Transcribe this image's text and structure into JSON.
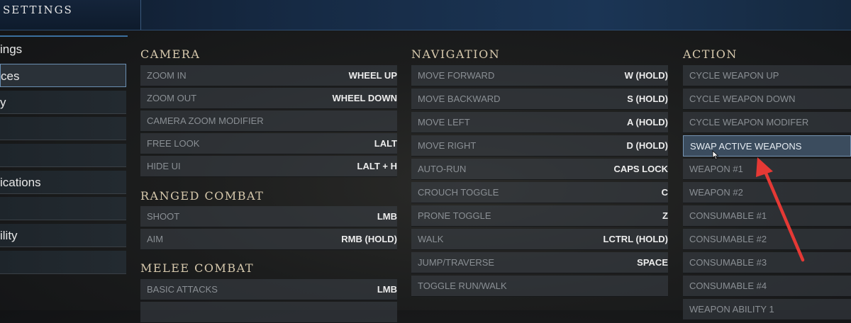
{
  "header": {
    "title": "SETTINGS"
  },
  "sidebar": {
    "items": [
      {
        "label": "ings"
      },
      {
        "label": "ces"
      },
      {
        "label": "y"
      },
      {
        "label": ""
      },
      {
        "label": ""
      },
      {
        "label": "ications"
      },
      {
        "label": ""
      },
      {
        "label": "ility"
      },
      {
        "label": ""
      }
    ]
  },
  "camera": {
    "title": "CAMERA",
    "rows": [
      {
        "label": "ZOOM IN",
        "key": "WHEEL UP"
      },
      {
        "label": "ZOOM OUT",
        "key": "WHEEL DOWN"
      },
      {
        "label": "CAMERA ZOOM MODIFIER",
        "key": ""
      },
      {
        "label": "FREE LOOK",
        "key": "LALT"
      },
      {
        "label": "HIDE UI",
        "key": "LALT + H"
      }
    ]
  },
  "ranged": {
    "title": "RANGED COMBAT",
    "rows": [
      {
        "label": "SHOOT",
        "key": "LMB"
      },
      {
        "label": "AIM",
        "key": "RMB (HOLD)"
      }
    ]
  },
  "melee": {
    "title": "MELEE COMBAT",
    "rows": [
      {
        "label": "BASIC ATTACKS",
        "key": "LMB"
      }
    ]
  },
  "navigation": {
    "title": "NAVIGATION",
    "rows": [
      {
        "label": "MOVE FORWARD",
        "key": "W (HOLD)"
      },
      {
        "label": "MOVE BACKWARD",
        "key": "S (HOLD)"
      },
      {
        "label": "MOVE LEFT",
        "key": "A (HOLD)"
      },
      {
        "label": "MOVE RIGHT",
        "key": "D (HOLD)"
      },
      {
        "label": "AUTO-RUN",
        "key": "CAPS LOCK"
      },
      {
        "label": "CROUCH TOGGLE",
        "key": "C"
      },
      {
        "label": "PRONE TOGGLE",
        "key": "Z"
      },
      {
        "label": "WALK",
        "key": "LCTRL (HOLD)"
      },
      {
        "label": "JUMP/TRAVERSE",
        "key": "SPACE"
      },
      {
        "label": "TOGGLE RUN/WALK",
        "key": ""
      }
    ]
  },
  "action": {
    "title": "ACTION",
    "rows": [
      {
        "label": "CYCLE WEAPON UP",
        "key": ""
      },
      {
        "label": "CYCLE WEAPON DOWN",
        "key": ""
      },
      {
        "label": "CYCLE WEAPON MODIFER",
        "key": ""
      },
      {
        "label": "SWAP ACTIVE WEAPONS",
        "key": ""
      },
      {
        "label": "WEAPON #1",
        "key": ""
      },
      {
        "label": "WEAPON #2",
        "key": ""
      },
      {
        "label": "CONSUMABLE #1",
        "key": ""
      },
      {
        "label": "CONSUMABLE #2",
        "key": ""
      },
      {
        "label": "CONSUMABLE #3",
        "key": ""
      },
      {
        "label": "CONSUMABLE #4",
        "key": ""
      },
      {
        "label": "WEAPON ABILITY 1",
        "key": ""
      }
    ]
  },
  "colors": {
    "accent": "#3b6f9e",
    "arrow": "#e53935",
    "highlight": "#3b4c5e"
  },
  "icons": {
    "cursor": "mouse-cursor-icon",
    "annotation": "red-arrow-icon"
  }
}
